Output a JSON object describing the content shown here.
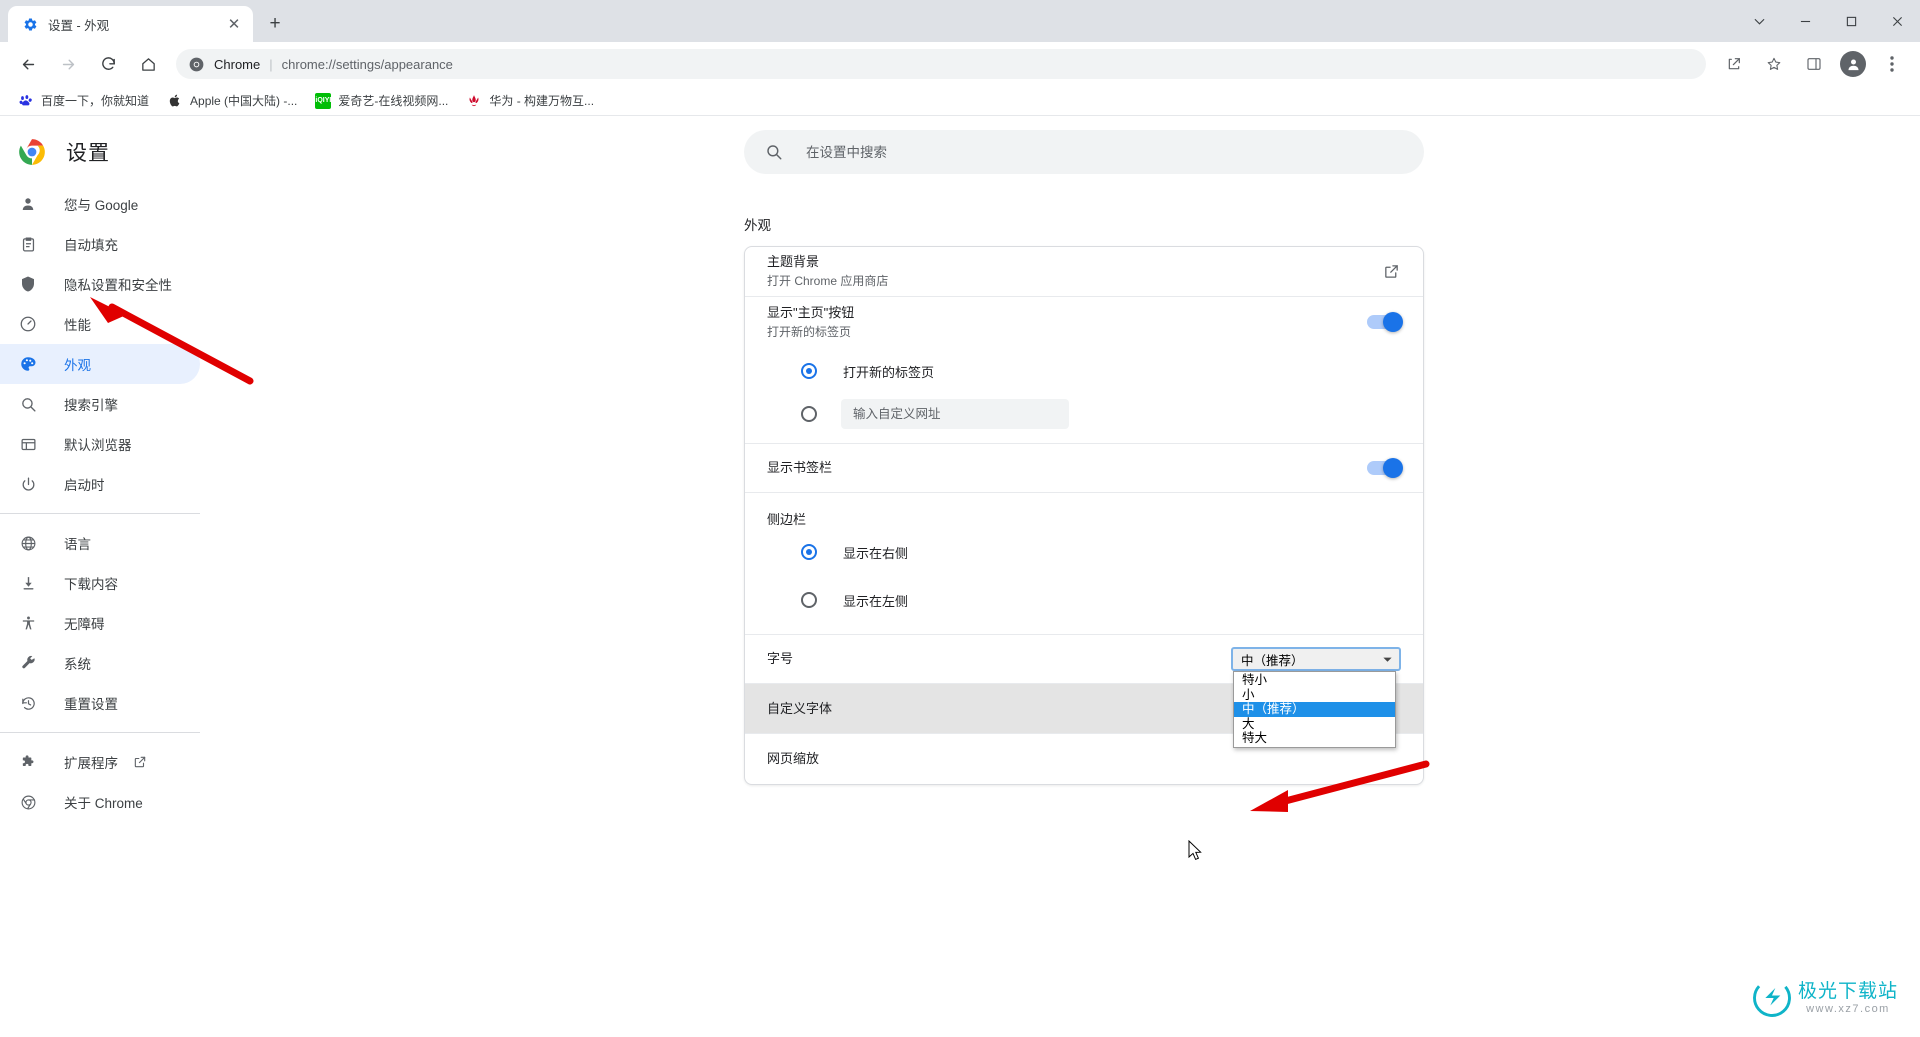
{
  "window": {
    "controls": [
      "chevron-down",
      "minimize",
      "maximize",
      "close"
    ]
  },
  "tab": {
    "title": "设置 - 外观",
    "favicon": "settings-gear-icon",
    "close_label": "✕",
    "new_tab_label": "+"
  },
  "toolbar": {
    "back": "←",
    "forward": "→",
    "reload": "⟳",
    "home": "⌂",
    "omnibox": {
      "chip": "Chrome",
      "separator": "|",
      "url": "chrome://settings/appearance"
    },
    "share_icon": "share-icon",
    "bookmark_icon": "star-icon",
    "sidepanel_icon": "side-panel-icon",
    "profile_icon": "profile-avatar-icon",
    "menu_icon": "three-dot-menu-icon"
  },
  "bookmarks": [
    {
      "label": "百度一下，你就知道",
      "icon": "baidu-icon",
      "color": "#2932e1"
    },
    {
      "label": "Apple (中国大陆) -...",
      "icon": "apple-icon",
      "color": "#333333"
    },
    {
      "label": "爱奇艺-在线视频网...",
      "icon": "iqiyi-icon",
      "color": "#00be06"
    },
    {
      "label": "华为 - 构建万物互...",
      "icon": "huawei-icon",
      "color": "#cf0a2c"
    }
  ],
  "sidebar": {
    "brand": "设置",
    "brand_icon": "chrome-logo-icon",
    "groups": [
      {
        "items": [
          {
            "label": "您与 Google",
            "icon": "person-icon",
            "active": false
          },
          {
            "label": "自动填充",
            "icon": "clipboard-icon",
            "active": false
          },
          {
            "label": "隐私设置和安全性",
            "icon": "shield-icon",
            "active": false
          },
          {
            "label": "性能",
            "icon": "speedometer-icon",
            "active": false
          },
          {
            "label": "外观",
            "icon": "palette-icon",
            "active": true
          },
          {
            "label": "搜索引擎",
            "icon": "search-icon",
            "active": false
          },
          {
            "label": "默认浏览器",
            "icon": "browser-window-icon",
            "active": false
          },
          {
            "label": "启动时",
            "icon": "power-icon",
            "active": false
          }
        ]
      },
      {
        "items": [
          {
            "label": "语言",
            "icon": "globe-icon",
            "active": false
          },
          {
            "label": "下载内容",
            "icon": "download-icon",
            "active": false
          },
          {
            "label": "无障碍",
            "icon": "accessibility-icon",
            "active": false
          },
          {
            "label": "系统",
            "icon": "wrench-icon",
            "active": false
          },
          {
            "label": "重置设置",
            "icon": "history-restore-icon",
            "active": false
          }
        ]
      },
      {
        "items": [
          {
            "label": "扩展程序",
            "icon": "puzzle-icon",
            "active": false,
            "external": true
          },
          {
            "label": "关于 Chrome",
            "icon": "chrome-outline-icon",
            "active": false
          }
        ]
      }
    ]
  },
  "main": {
    "search": {
      "placeholder": "在设置中搜索",
      "value": "",
      "icon": "search-icon"
    },
    "section_title": "外观",
    "rows": {
      "theme": {
        "title": "主题背景",
        "subtitle": "打开 Chrome 应用商店",
        "action_icon": "open-in-new-icon"
      },
      "home_button": {
        "title": "显示\"主页\"按钮",
        "subtitle": "打开新的标签页",
        "toggle_on": true
      },
      "home_options": [
        {
          "label": "打开新的标签页",
          "selected": true,
          "type": "radio"
        },
        {
          "label": "",
          "selected": false,
          "type": "radio-input",
          "placeholder": "输入自定义网址",
          "value": ""
        }
      ],
      "bookmarks_bar": {
        "title": "显示书签栏",
        "toggle_on": true
      },
      "side_panel": {
        "group_label": "侧边栏",
        "options": [
          {
            "label": "显示在右侧",
            "selected": true
          },
          {
            "label": "显示在左侧",
            "selected": false
          }
        ]
      },
      "font_size": {
        "title": "字号",
        "selected": "中（推荐）",
        "options": [
          "特小",
          "小",
          "中（推荐）",
          "大",
          "特大"
        ],
        "open": true,
        "highlight_color": "#1e90e8"
      },
      "custom_fonts": {
        "title": "自定义字体",
        "hovered": true
      },
      "page_zoom": {
        "title": "网页缩放"
      }
    }
  },
  "annotations": {
    "arrow_color": "#e00000",
    "arrow_to_appearance": "points at 外观 sidebar item",
    "arrow_to_fontsize": "points at 字号 dropdown"
  },
  "watermark": {
    "title": "极光下载站",
    "subtitle": "www.xz7.com",
    "color": "#0fb4c8"
  }
}
